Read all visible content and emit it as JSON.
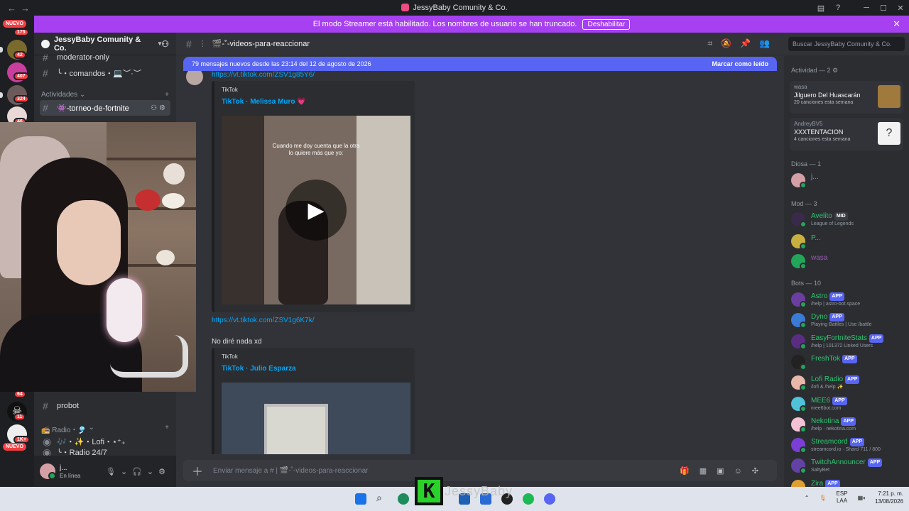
{
  "titlebar": {
    "title": "JessyBaby Comunity & Co."
  },
  "streamer_banner": {
    "text": "El modo Streamer está habilitado. Los nombres de usuario se han truncado.",
    "button": "Deshabilitar"
  },
  "guilds": {
    "nuevo_top": "NUEVO",
    "nuevo_bottom": "NUEVO",
    "badges": [
      "175",
      "42",
      "407",
      "324",
      "46",
      "64",
      "11",
      "1K+"
    ]
  },
  "server": {
    "name": "JessyBaby Comunity & Co."
  },
  "channels": {
    "items_top": [
      "moderator-only",
      "╰・comandos・💻︶·︶"
    ],
    "category_actividades": "Actividades",
    "active_channel": "👾-torneo-de-fortnite",
    "items_bottom": [
      "probot"
    ],
    "category_radio": "📻 Radio・🎐",
    "voice": [
      "🎶・✨・Lofi・⋆⁺₊",
      "╰・Radio 24/7"
    ]
  },
  "user_panel": {
    "name": "j...",
    "status": "En línea"
  },
  "chat": {
    "channel_name": "🎬-˚-videos-para-reaccionar",
    "search_placeholder": "Buscar JessyBaby Comunity & Co.",
    "new_messages": "79 mensajes nuevos desde las 23:14 del 12 de agosto de 2026",
    "mark_read": "Marcar como leído",
    "link1": "https://vt.tiktok.com/ZSV1g85Y6/",
    "embed1_provider": "TikTok",
    "embed1_title": "TikTok · Melissa Muro 💗",
    "embed1_caption": "Cuando me doy cuenta que la otra lo quiere más que yo:",
    "link2": "https://vt.tiktok.com/ZSV1g6K7k/",
    "message_text": "No diré nada xd",
    "embed2_provider": "TikTok",
    "embed2_title": "TikTok · Julio Esparza",
    "composer_placeholder": "Enviar mensaje a # | 🎬-˚-videos-para-reaccionar"
  },
  "members": {
    "activity_header": "Actividad — 2",
    "activities": [
      {
        "user": "wasa",
        "title": "Jilguero Del Huascarán",
        "sub": "20 canciones esta semana",
        "art_color": "#a07a3c"
      },
      {
        "user": "AndreyBV5",
        "title": "XXXTENTACION",
        "sub": "4 canciones esta semana",
        "art_color": "#f2f2f2"
      }
    ],
    "diosa_header": "Diosa — 1",
    "diosa": [
      {
        "name": "j...",
        "color": "#949ba4"
      }
    ],
    "mod_header": "Mod — 3",
    "mods": [
      {
        "name": "Avelito",
        "tag": "MID",
        "status": "League of Legends",
        "color": "#2dc770"
      },
      {
        "name": "P...",
        "status": "",
        "color": "#2dc770"
      },
      {
        "name": "wasa",
        "status": "",
        "color": "#9b59b6"
      }
    ],
    "bots_header": "Bots — 10",
    "bots": [
      {
        "name": "Astro",
        "status": "/help | astro-bot.space",
        "color": "#2dc770",
        "av": "#6b3fa0"
      },
      {
        "name": "Dyno",
        "status": "Playing Battles | Use /battle",
        "color": "#2dc770",
        "av": "#3a7bd5"
      },
      {
        "name": "EasyFortniteStats",
        "status": "/help | 101372 Linked Users",
        "color": "#2dc770",
        "av": "#5a2d82"
      },
      {
        "name": "FreshTok",
        "status": "",
        "color": "#2dc770",
        "av": "#222"
      },
      {
        "name": "Lofi Radio",
        "status": "/lofi & /help ✨",
        "color": "#2dc770",
        "av": "#e8b8a8"
      },
      {
        "name": "MEE6",
        "status": "mee6bot.com",
        "color": "#2dc770",
        "av": "#4fc3d9"
      },
      {
        "name": "Nekotina",
        "status": "/help · nekotina.com",
        "color": "#2dc770",
        "av": "#f4c2d4"
      },
      {
        "name": "Streamcord",
        "status": "streamcord.io · Shard 711 / 800",
        "color": "#2dc770",
        "av": "#7b3fd5"
      },
      {
        "name": "TwitchAnnouncer",
        "status": "SaltyBet",
        "color": "#2dc770",
        "av": "#6441a5"
      },
      {
        "name": "Zira",
        "status": "",
        "color": "#2dc770",
        "av": "#e0a030"
      }
    ],
    "app_tag": "APP"
  },
  "taskbar": {
    "lang_top": "ESP",
    "lang_bottom": "LAA",
    "time": "7:21 p. m.",
    "date": "13/08/2026",
    "overlay_letter": "K",
    "overlay_name": "JessyBaby"
  }
}
